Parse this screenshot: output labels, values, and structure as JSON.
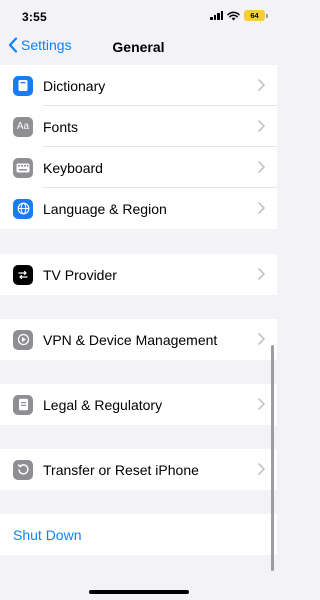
{
  "status_bar": {
    "time": "3:55",
    "battery": "64"
  },
  "nav": {
    "back_label": "Settings",
    "title": "General"
  },
  "groups": [
    {
      "items": [
        {
          "label": "Dictionary",
          "icon": "book-icon",
          "icon_color": "#1a7cf5"
        },
        {
          "label": "Fonts",
          "icon": "fonts-icon",
          "icon_color": "#8e8e93",
          "icon_text": "Aa"
        },
        {
          "label": "Keyboard",
          "icon": "keyboard-icon",
          "icon_color": "#8e8e93"
        },
        {
          "label": "Language & Region",
          "icon": "globe-icon",
          "icon_color": "#1a7cf5"
        }
      ]
    },
    {
      "items": [
        {
          "label": "TV Provider",
          "icon": "tv-provider-icon",
          "icon_color": "#000000"
        }
      ]
    },
    {
      "items": [
        {
          "label": "VPN & Device Management",
          "icon": "gear-icon",
          "icon_color": "#8e8e93"
        }
      ]
    },
    {
      "items": [
        {
          "label": "Legal & Regulatory",
          "icon": "document-icon",
          "icon_color": "#8e8e93"
        }
      ]
    },
    {
      "items": [
        {
          "label": "Transfer or Reset iPhone",
          "icon": "reset-icon",
          "icon_color": "#8e8e93"
        }
      ]
    }
  ],
  "shutdown": {
    "label": "Shut Down"
  },
  "colors": {
    "accent": "#0a84ff",
    "background": "#f2f2f7"
  }
}
